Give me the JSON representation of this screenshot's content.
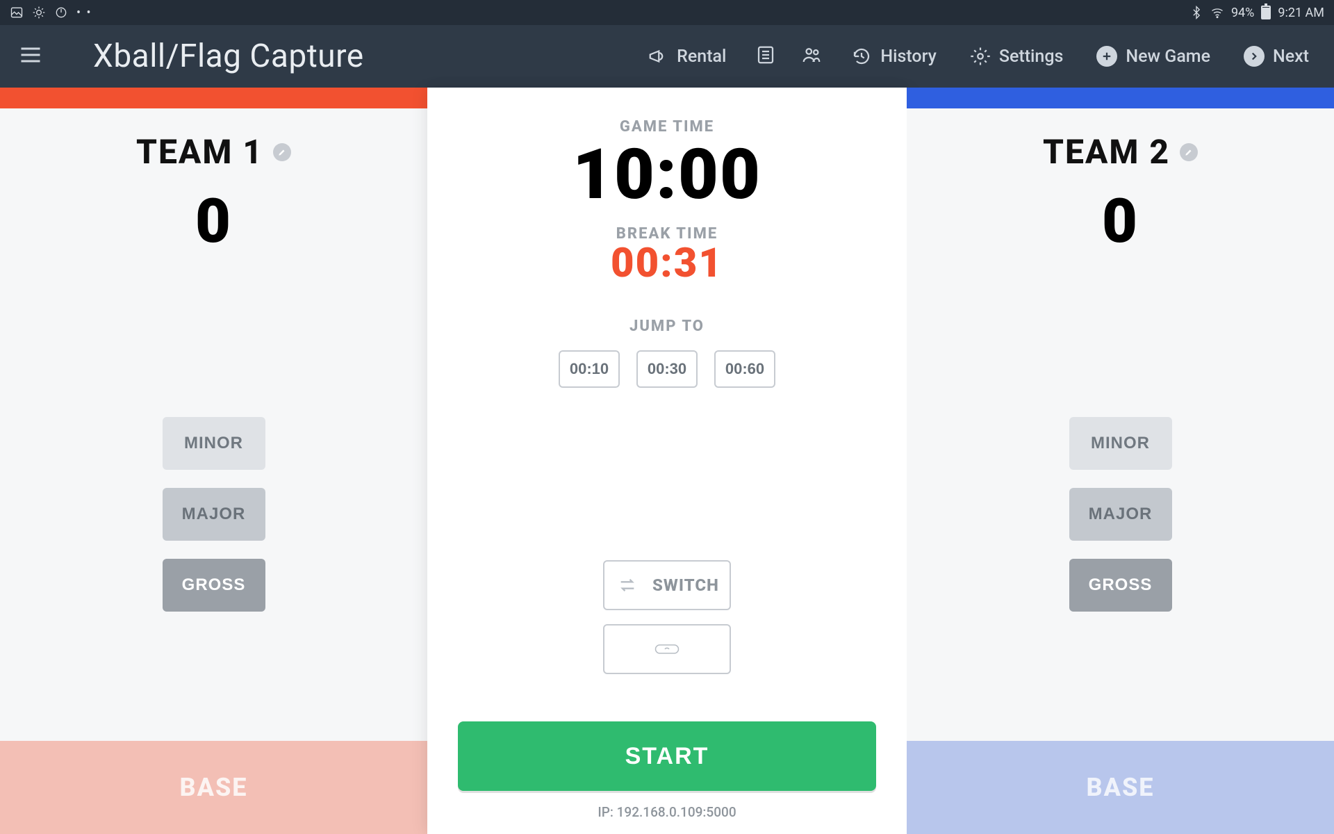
{
  "statusbar": {
    "battery_pct": "94%",
    "time": "9:21 AM"
  },
  "appbar": {
    "title": "Xball/Flag Capture",
    "rental": "Rental",
    "history": "History",
    "settings": "Settings",
    "new_game": "New Game",
    "next": "Next"
  },
  "teams": {
    "left": {
      "name": "TEAM 1",
      "score": "0",
      "minor": "MINOR",
      "major": "MAJOR",
      "gross": "GROSS",
      "base": "BASE"
    },
    "right": {
      "name": "TEAM 2",
      "score": "0",
      "minor": "MINOR",
      "major": "MAJOR",
      "gross": "GROSS",
      "base": "BASE"
    }
  },
  "center": {
    "game_time_label": "GAME TIME",
    "game_time": "10:00",
    "break_time_label": "BREAK TIME",
    "break_time": "00:31",
    "jump_to_label": "JUMP TO",
    "jump_options": {
      "a": "00:10",
      "b": "00:30",
      "c": "00:60"
    },
    "switch_label": "SWITCH",
    "start_label": "START",
    "ip": "IP: 192.168.0.109:5000"
  }
}
